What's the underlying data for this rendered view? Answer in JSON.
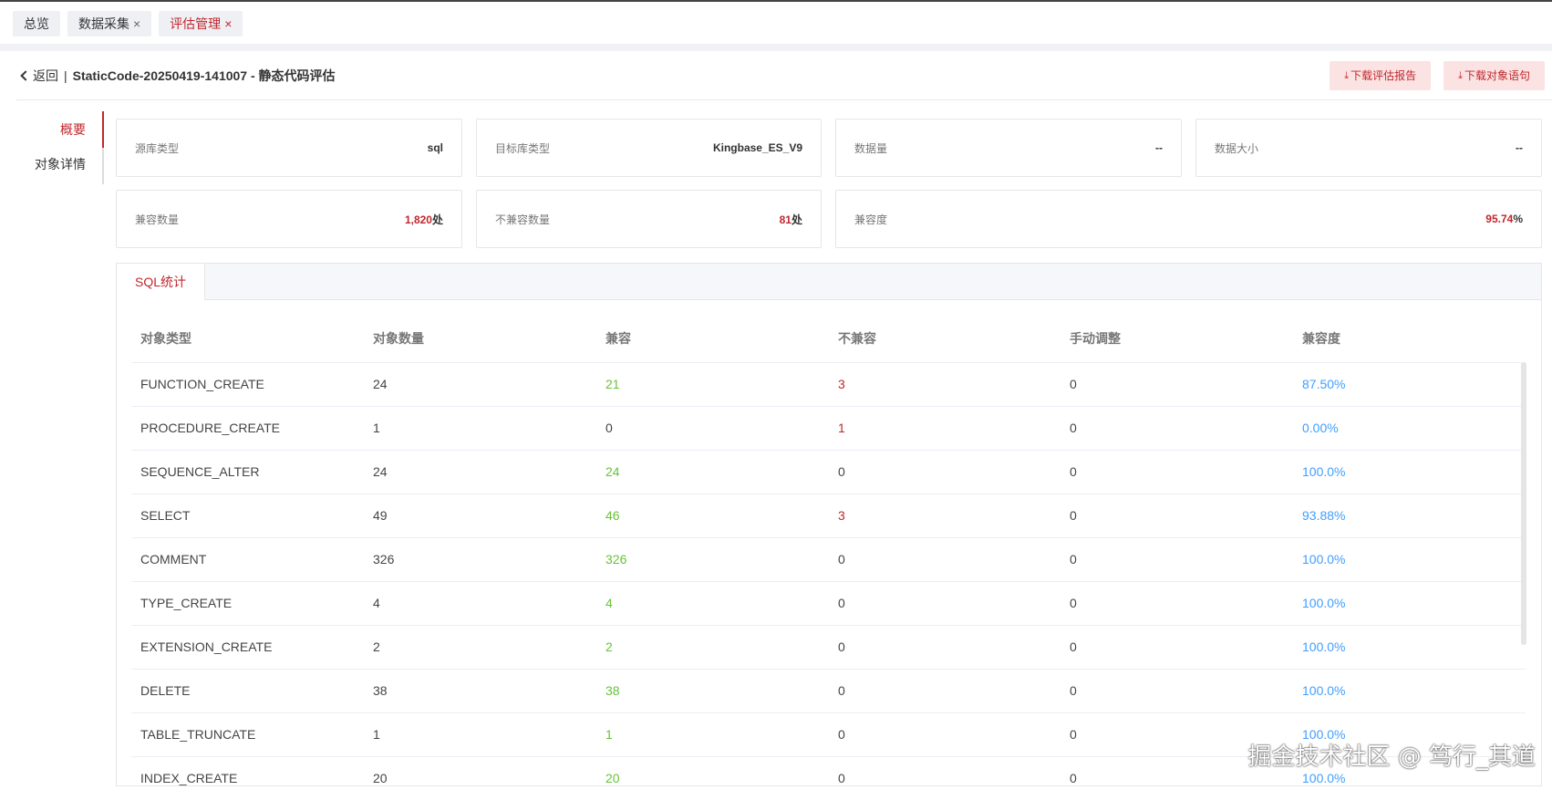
{
  "tabs": [
    {
      "label": "总览",
      "closable": false,
      "active": false
    },
    {
      "label": "数据采集",
      "closable": true,
      "active": false
    },
    {
      "label": "评估管理",
      "closable": true,
      "active": true
    }
  ],
  "header": {
    "back_label": "返回",
    "separator": "|",
    "title": "StaticCode-20250419-141007 - 静态代码评估",
    "buttons": {
      "download_report": "下载评估报告",
      "download_objects": "下载对象语句"
    }
  },
  "nav": [
    {
      "label": "概要",
      "active": true
    },
    {
      "label": "对象详情",
      "active": false
    }
  ],
  "cards": {
    "source_type": {
      "label": "源库类型",
      "value": "sql"
    },
    "target_type": {
      "label": "目标库类型",
      "value": "Kingbase_ES_V9"
    },
    "data_count": {
      "label": "数据量",
      "value": "--"
    },
    "data_size": {
      "label": "数据大小",
      "value": "--"
    },
    "compatible": {
      "label": "兼容数量",
      "value": "1,820",
      "unit": "处"
    },
    "incompatible": {
      "label": "不兼容数量",
      "value": "81",
      "unit": "处"
    },
    "compat_rate": {
      "label": "兼容度",
      "value": "95.74",
      "unit": "%"
    }
  },
  "panel": {
    "tab_label": "SQL统计",
    "columns": [
      "对象类型",
      "对象数量",
      "兼容",
      "不兼容",
      "手动调整",
      "兼容度"
    ],
    "rows": [
      {
        "type": "FUNCTION_CREATE",
        "count": "24",
        "compatible": "21",
        "incompatible": "3",
        "manual": "0",
        "rate": "87.50%"
      },
      {
        "type": "PROCEDURE_CREATE",
        "count": "1",
        "compatible": "0",
        "incompatible": "1",
        "manual": "0",
        "rate": "0.00%"
      },
      {
        "type": "SEQUENCE_ALTER",
        "count": "24",
        "compatible": "24",
        "incompatible": "0",
        "manual": "0",
        "rate": "100.0%"
      },
      {
        "type": "SELECT",
        "count": "49",
        "compatible": "46",
        "incompatible": "3",
        "manual": "0",
        "rate": "93.88%"
      },
      {
        "type": "COMMENT",
        "count": "326",
        "compatible": "326",
        "incompatible": "0",
        "manual": "0",
        "rate": "100.0%"
      },
      {
        "type": "TYPE_CREATE",
        "count": "4",
        "compatible": "4",
        "incompatible": "0",
        "manual": "0",
        "rate": "100.0%"
      },
      {
        "type": "EXTENSION_CREATE",
        "count": "2",
        "compatible": "2",
        "incompatible": "0",
        "manual": "0",
        "rate": "100.0%"
      },
      {
        "type": "DELETE",
        "count": "38",
        "compatible": "38",
        "incompatible": "0",
        "manual": "0",
        "rate": "100.0%"
      },
      {
        "type": "TABLE_TRUNCATE",
        "count": "1",
        "compatible": "1",
        "incompatible": "0",
        "manual": "0",
        "rate": "100.0%"
      },
      {
        "type": "INDEX_CREATE",
        "count": "20",
        "compatible": "20",
        "incompatible": "0",
        "manual": "0",
        "rate": "100.0%"
      }
    ]
  },
  "watermark": "掘金技术社区 @ 笃行_其道"
}
